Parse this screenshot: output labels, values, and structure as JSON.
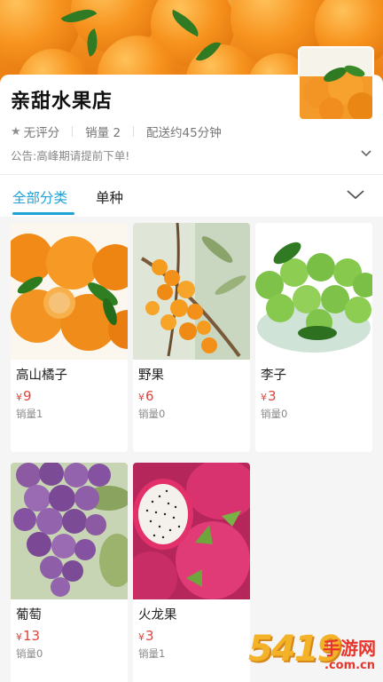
{
  "shop": {
    "name": "亲甜水果店",
    "rating": "无评分",
    "sales": "销量 2",
    "delivery": "配送约45分钟",
    "notice": "公告:高峰期请提前下单!"
  },
  "tabs": [
    {
      "label": "全部分类",
      "active": true
    },
    {
      "label": "单种",
      "active": false
    }
  ],
  "products": [
    {
      "name": "高山橘子",
      "currency": "¥",
      "price": "9",
      "sold": "销量1",
      "image": "tangerines"
    },
    {
      "name": "野果",
      "currency": "¥",
      "price": "6",
      "sold": "销量0",
      "image": "sea-buckthorn"
    },
    {
      "name": "李子",
      "currency": "¥",
      "price": "3",
      "sold": "销量0",
      "image": "green-plums"
    },
    {
      "name": "葡萄",
      "currency": "¥",
      "price": "13",
      "sold": "销量0",
      "image": "grapes"
    },
    {
      "name": "火龙果",
      "currency": "¥",
      "price": "3",
      "sold": "销量1",
      "image": "dragon-fruit"
    }
  ],
  "watermark": {
    "big": "5419",
    "small": "手游网",
    "url": ".com.cn"
  },
  "colors": {
    "accent": "#1fa3d6",
    "price": "#e0443c"
  }
}
